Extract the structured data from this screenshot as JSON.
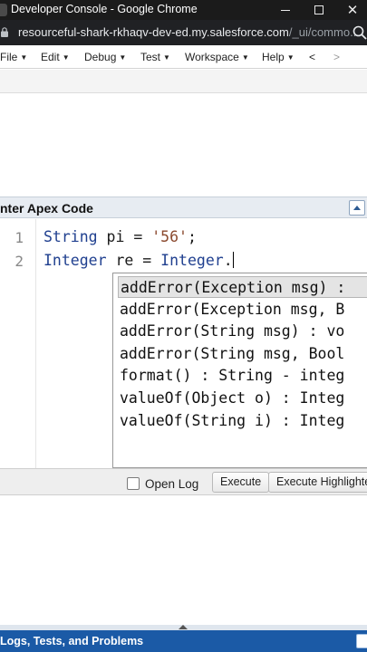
{
  "window": {
    "title": "Developer Console - Google Chrome",
    "controls": [
      "minimize-icon",
      "maximize-icon",
      "close-icon"
    ]
  },
  "browser": {
    "url_host": "resourceful-shark-rkhaqv-dev-ed.my.salesforce.com",
    "url_path": "/_ui/commo..."
  },
  "menu": {
    "items": [
      {
        "label": "File"
      },
      {
        "label": "Edit"
      },
      {
        "label": "Debug"
      },
      {
        "label": "Test"
      },
      {
        "label": "Workspace"
      },
      {
        "label": "Help"
      }
    ],
    "back_label": "<",
    "forward_label": ">"
  },
  "panel": {
    "title": "nter Apex Code"
  },
  "editor": {
    "lines": [
      {
        "number": "1",
        "tokens": [
          "String",
          " pi = ",
          "'56'",
          ";"
        ]
      },
      {
        "number": "2",
        "tokens": [
          "Integer",
          " re = ",
          "Integer",
          "."
        ]
      }
    ]
  },
  "autocomplete": {
    "selected_index": 0,
    "items": [
      "addError(Exception msg) :",
      "addError(Exception msg, B",
      "addError(String msg) : vo",
      "addError(String msg, Bool",
      "format() : String - integ",
      "valueOf(Object o) : Integ",
      "valueOf(String i) : Integ"
    ]
  },
  "exec_bar": {
    "open_log_label": "Open Log",
    "open_log_checked": false,
    "execute_label": "Execute",
    "execute_highlighted_label": "Execute Highlighte"
  },
  "bottom_panel": {
    "title": "Logs, Tests, and Problems"
  },
  "colors": {
    "titlebar": "#1b1b1b",
    "keyword": "#1f3f8f",
    "string_literal": "#8b4a2f",
    "bottom_bar": "#1b5aa6"
  }
}
